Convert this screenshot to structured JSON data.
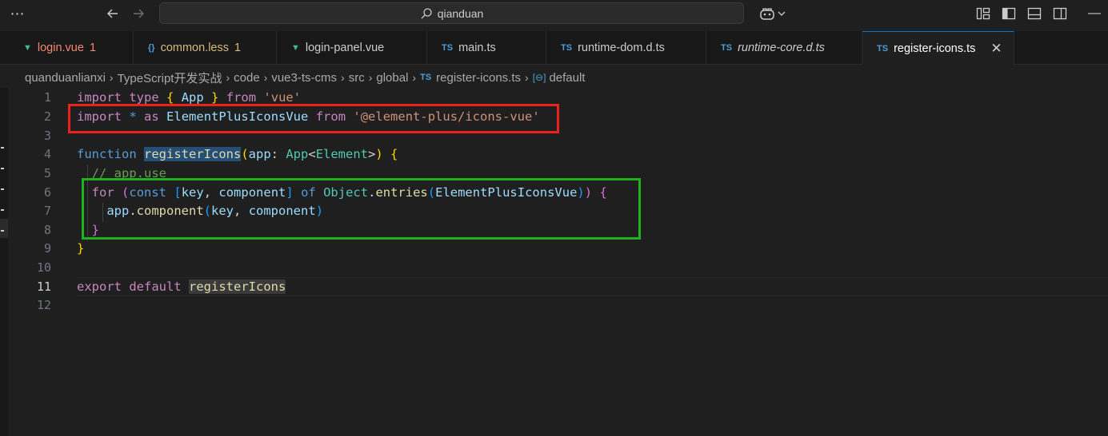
{
  "titlebar": {
    "menu_icon": "ellipsis-icon",
    "search_text": "qianduan"
  },
  "tabs": [
    {
      "icon": "V",
      "label": "login.vue",
      "badge": "1",
      "color": "#f48771"
    },
    {
      "icon": "{}",
      "label": "common.less",
      "badge": "1",
      "color": "#d7ba7d"
    },
    {
      "icon": "V",
      "label": "login-panel.vue",
      "badge": "",
      "color": "#cccccc"
    },
    {
      "icon": "TS",
      "label": "main.ts",
      "badge": "",
      "color": "#cccccc"
    },
    {
      "icon": "TS",
      "label": "runtime-dom.d.ts",
      "badge": "",
      "color": "#cccccc"
    },
    {
      "icon": "TS",
      "label": "runtime-core.d.ts",
      "badge": "",
      "color": "#cccccc"
    },
    {
      "icon": "TS",
      "label": "register-icons.ts",
      "badge": "",
      "color": "#ffffff"
    }
  ],
  "breadcrumb": {
    "items": [
      "quanduanlianxi",
      "TypeScript开发实战",
      "code",
      "vue3-ts-cms",
      "src",
      "global"
    ],
    "file_icon": "TS",
    "file": "register-icons.ts",
    "symbol": "default"
  },
  "editor": {
    "line_numbers": [
      "1",
      "2",
      "3",
      "4",
      "5",
      "6",
      "7",
      "8",
      "9",
      "10",
      "11",
      "12"
    ],
    "current_line": "11",
    "line2": {
      "import": "import",
      "star": "*",
      "as": "as",
      "name": "ElementPlusIconsVue",
      "from": "from",
      "source": "'@element-plus/icons-vue'"
    },
    "line1": {
      "import": "import",
      "type": "type",
      "open": "{",
      "name": "App",
      "close": "}",
      "from": "from",
      "source": "'vue'"
    },
    "line4": {
      "function": "function",
      "name": "registerIcons",
      "param": "app",
      "type": "App",
      "generic": "Element"
    },
    "line5": {
      "comment": "// app.use"
    },
    "line6": {
      "for": "for",
      "const": "const",
      "key": "key",
      "component": "component",
      "of": "of",
      "object": "Object",
      "method": "entries",
      "arg": "ElementPlusIconsVue"
    },
    "line7": {
      "app": "app",
      "method": "component",
      "key": "key",
      "component": "component"
    },
    "line11": {
      "export": "export",
      "default": "default",
      "name": "registerIcons"
    }
  },
  "annotations": {
    "red": "#e8231a",
    "green": "#1fb21f"
  },
  "colors": {
    "accent": "#0078d4",
    "background": "#1f1f1f"
  }
}
